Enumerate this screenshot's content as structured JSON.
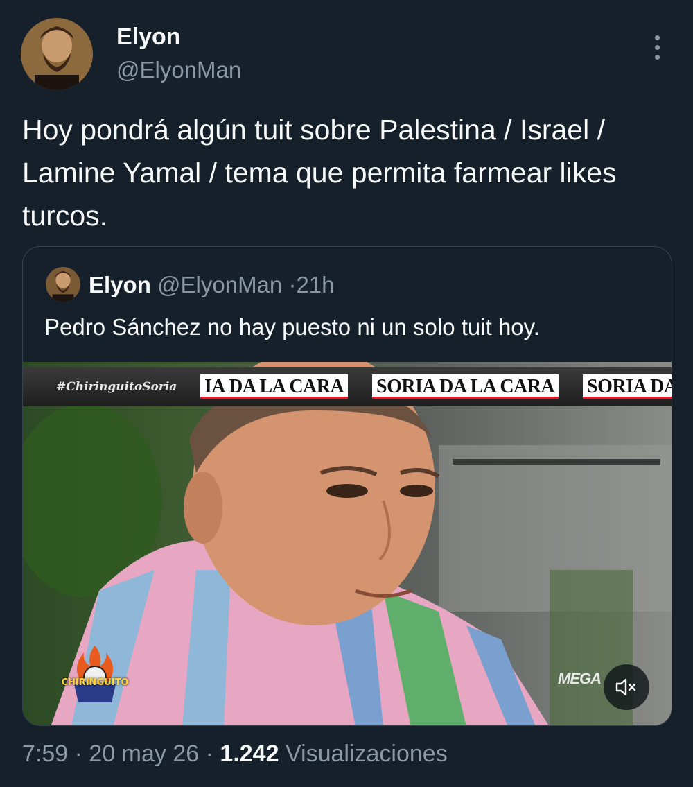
{
  "author": {
    "display_name": "Elyon",
    "handle": "@ElyonMan"
  },
  "tweet": {
    "text": "Hoy pondrá algún tuit sobre Palestina / Israel / Lamine Yamal / tema que permita farmear likes turcos."
  },
  "quoted_tweet": {
    "display_name": "Elyon",
    "handle": "@ElyonMan",
    "separator": "·",
    "time": "21h",
    "text": "Pedro Sánchez no hay puesto ni un solo tuit hoy.",
    "media": {
      "hashtag": "#ChiringuitoSoria",
      "ticker": [
        "IA DA LA CARA",
        "SORIA DA LA CARA",
        "SORIA DA"
      ],
      "channel_logo": "MEGA",
      "show_logo": "CHIRINGUITO",
      "mute_icon": "speaker-muted-icon"
    }
  },
  "footer": {
    "time": "7:59",
    "sep1": "·",
    "date": "20 may 26",
    "sep2": "·",
    "views_count": "1.242",
    "views_label": "Visualizaciones"
  },
  "colors": {
    "background": "#15202b",
    "text_primary": "#f7f9f9",
    "text_secondary": "#8b98a5",
    "border": "#38444d"
  }
}
